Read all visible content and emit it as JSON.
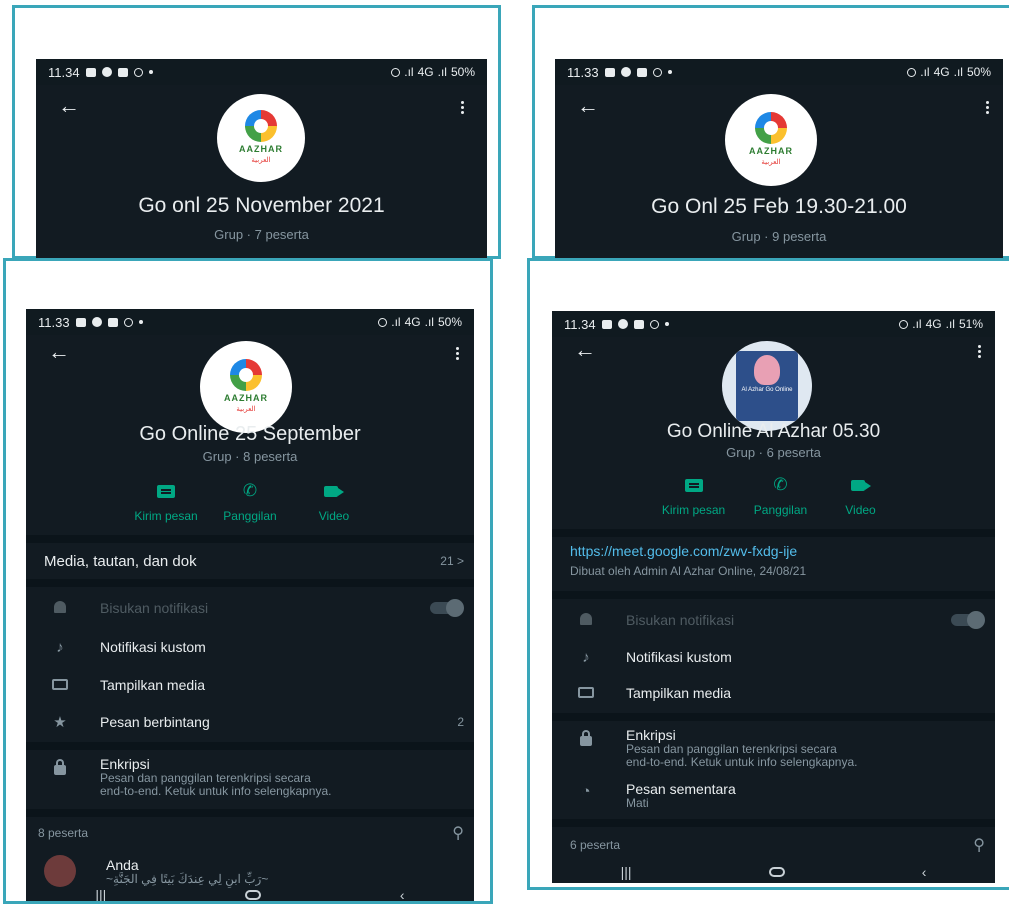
{
  "status_icons": [
    "message-icon",
    "account-icon",
    "mail-icon",
    "lock-icon",
    "dot-icon",
    "alarm-icon",
    "signal-icon",
    "battery-icon"
  ],
  "accent_color": "#00a884",
  "frame_color": "#3aa6b9",
  "logo": {
    "text": "AAZHAR",
    "arabic": "العربية"
  },
  "actions": {
    "message": "Kirim pesan",
    "call": "Panggilan",
    "video": "Video"
  },
  "p1": {
    "status": {
      "time": "11.34",
      "net": "4G",
      "battery": "50%"
    },
    "title": "Go onl 25 November 2021",
    "subtitle": "Grup · 7 peserta"
  },
  "p2": {
    "status": {
      "time": "11.33",
      "net": "4G",
      "battery": "50%"
    },
    "title": "Go Onl 25 Feb 19.30-21.00",
    "subtitle": "Grup · 9 peserta"
  },
  "p3": {
    "status": {
      "time": "11.33",
      "net": "4G",
      "battery": "50%"
    },
    "title": "Go Online 25 September",
    "subtitle": "Grup · 8 peserta",
    "media_label": "Media, tautan, dan dok",
    "media_count": "21 >",
    "settings": [
      {
        "label": "Bisukan notifikasi"
      },
      {
        "label": "Notifikasi kustom"
      },
      {
        "label": "Tampilkan media"
      },
      {
        "label": "Pesan berbintang",
        "count": "2"
      }
    ],
    "encryption": {
      "title": "Enkripsi",
      "desc1": "Pesan dan panggilan terenkripsi secara",
      "desc2": "end-to-end. Ketuk untuk info selengkapnya."
    },
    "participants": "8 peserta",
    "member": {
      "name": "Anda",
      "status": "~رَبِّ ابنِ لِي عِندَكَ بَيتًا فِي الجَنَّةِ~"
    }
  },
  "p4": {
    "status": {
      "time": "11.34",
      "net": "4G",
      "battery": "51%"
    },
    "title": "Go Online Al Azhar 05.30",
    "subtitle": "Grup · 6 peserta",
    "avatar_caption": "Al Azhar Go Online",
    "link": "https://meet.google.com/zwv-fxdg-ije",
    "created_by": "Dibuat oleh Admin Al Azhar Online, 24/08/21",
    "settings": [
      {
        "label": "Bisukan notifikasi"
      },
      {
        "label": "Notifikasi kustom"
      },
      {
        "label": "Tampilkan media"
      }
    ],
    "encryption": {
      "title": "Enkripsi",
      "desc1": "Pesan dan panggilan terenkripsi secara",
      "desc2": "end-to-end. Ketuk untuk info selengkapnya."
    },
    "temp": {
      "title": "Pesan sementara",
      "value": "Mati"
    },
    "participants": "6 peserta"
  }
}
